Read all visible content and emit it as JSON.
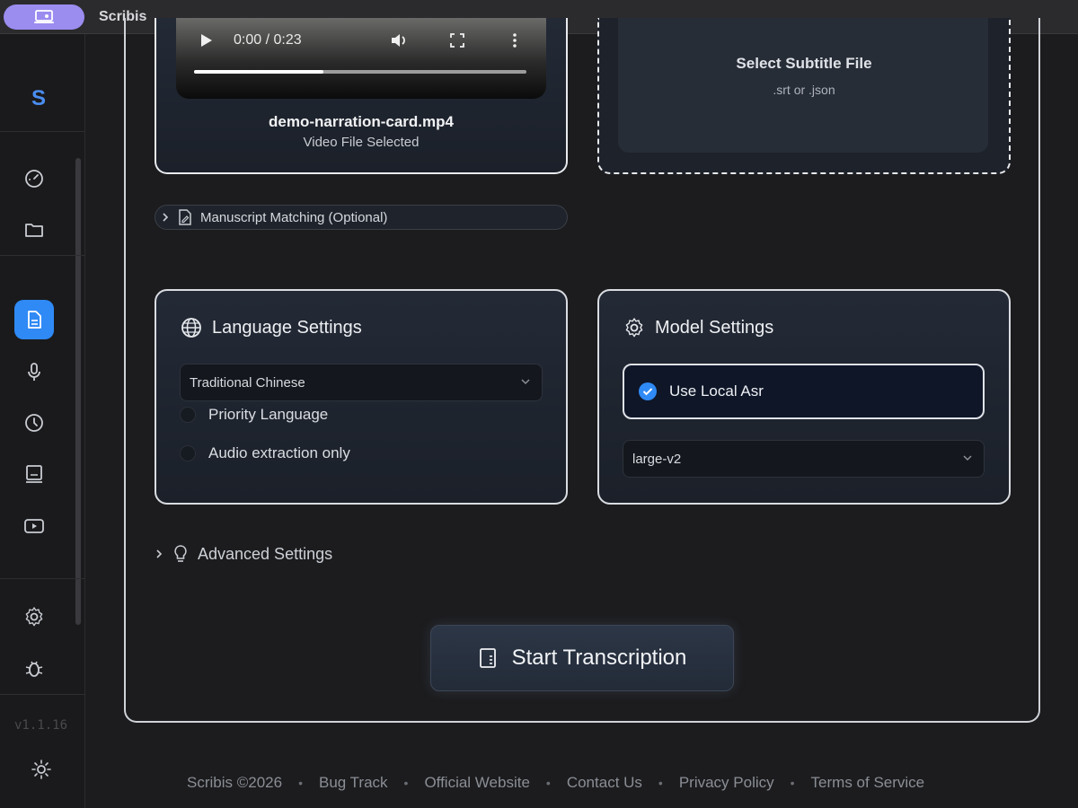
{
  "app": {
    "title": "Scribis",
    "version": "v1.1.16",
    "logo_letter": "S"
  },
  "colors": {
    "accent": "#2f8af5",
    "app_pill": "#9b8cf0",
    "logo": "#4a8df0"
  },
  "sidebar": {
    "items": [
      {
        "name": "dashboard",
        "icon": "gauge-icon"
      },
      {
        "name": "files",
        "icon": "folder-icon"
      },
      {
        "name": "transcribe",
        "icon": "document-icon",
        "active": true
      },
      {
        "name": "record",
        "icon": "microphone-icon"
      },
      {
        "name": "history",
        "icon": "clock-icon"
      },
      {
        "name": "subtitles",
        "icon": "monitor-icon"
      },
      {
        "name": "youtube",
        "icon": "play-icon"
      },
      {
        "name": "settings",
        "icon": "gear-icon"
      },
      {
        "name": "debug",
        "icon": "bug-icon"
      },
      {
        "name": "theme",
        "icon": "sun-icon"
      }
    ]
  },
  "video": {
    "time_display": "0:00 / 0:23",
    "progress": 0.39,
    "filename": "demo-narration-card.mp4",
    "status": "Video File Selected"
  },
  "subtitle": {
    "title": "Select Subtitle File",
    "hint": ".srt or .json"
  },
  "manuscript": {
    "label": "Manuscript Matching (Optional)"
  },
  "language": {
    "title": "Language Settings",
    "selected": "Traditional Chinese",
    "options": [
      {
        "label": "Priority Language",
        "checked": false
      },
      {
        "label": "Audio extraction only",
        "checked": false
      }
    ]
  },
  "model": {
    "title": "Model Settings",
    "local_asr_label": "Use Local Asr",
    "local_asr_checked": true,
    "selected": "large-v2"
  },
  "advanced": {
    "label": "Advanced Settings"
  },
  "start_button": {
    "label": "Start Transcription"
  },
  "footer": {
    "links": [
      "Scribis ©2026",
      "Bug Track",
      "Official Website",
      "Contact Us",
      "Privacy Policy",
      "Terms of Service"
    ]
  }
}
